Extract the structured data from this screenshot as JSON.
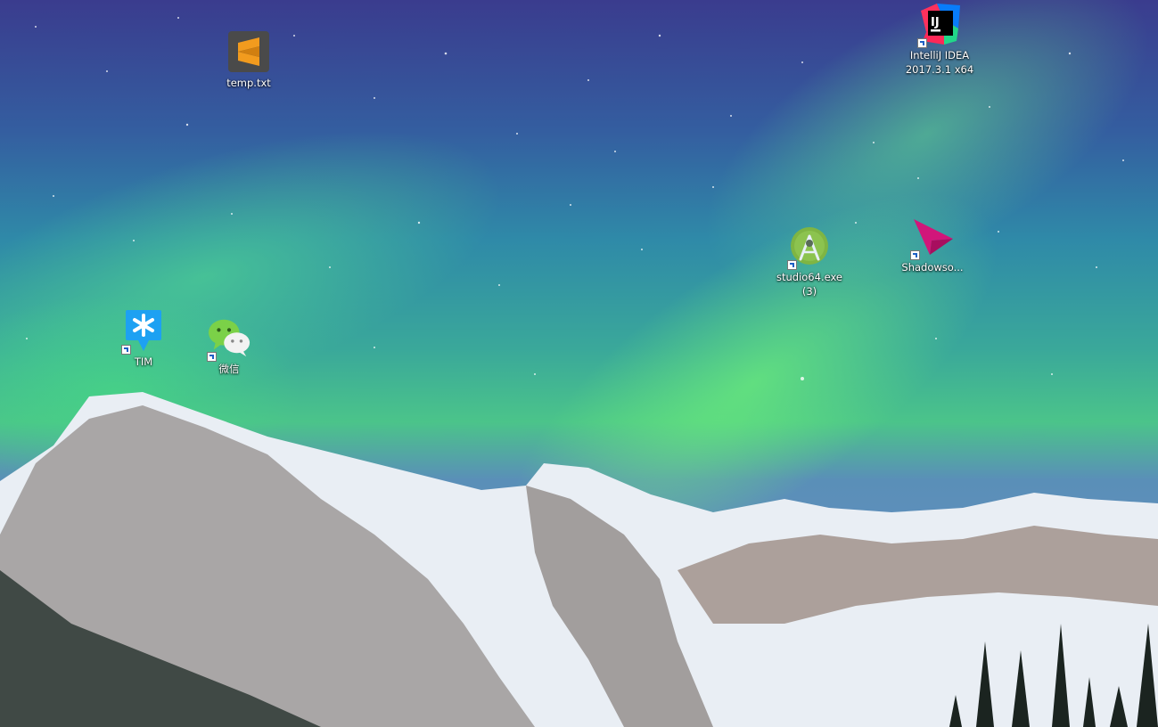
{
  "desktop": {
    "icons": [
      {
        "label": "temp.txt",
        "icon": "sublime-text-icon"
      },
      {
        "label": "IntelliJ IDEA 2017.3.1 x64",
        "icon": "intellij-idea-icon"
      },
      {
        "label": "studio64.exe (3)",
        "icon": "android-studio-icon"
      },
      {
        "label": "Shadowso...",
        "icon": "shadowsocks-icon"
      },
      {
        "label": "TIM",
        "icon": "tim-icon"
      },
      {
        "label": "微信",
        "icon": "wechat-icon"
      }
    ]
  },
  "colors": {
    "sublime_orange": "#f29b1e",
    "sublime_bg": "#4a4a4a",
    "intellij_black": "#000000",
    "android_green": "#7fb543",
    "shadowsocks_pink": "#d1167a",
    "tim_blue": "#1da1f2",
    "wechat_green": "#7bd148"
  }
}
